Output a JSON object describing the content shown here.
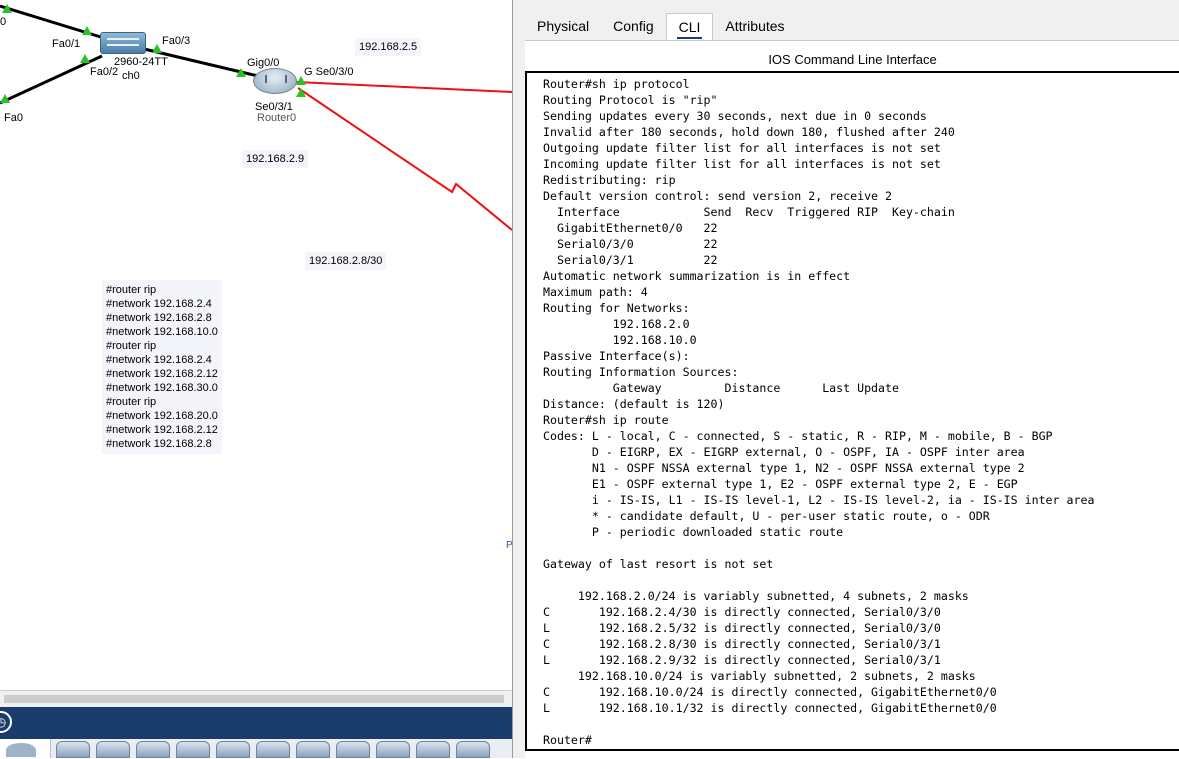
{
  "workspace": {
    "links": {
      "black_color": "#000000",
      "red_color": "#ee1111",
      "port_color": "#29c229"
    },
    "labels": {
      "top_left_cut": "0",
      "fa01": "Fa0/1",
      "fa03": "Fa0/3",
      "fa02": "Fa0/2",
      "switch_model": "2960-24TT",
      "switch_name": "ch0",
      "fa0": "Fa0",
      "gig00": "Gig0/0",
      "se030": "G Se0/3/0",
      "se031": "Se0/3/1",
      "router_name": "Router0"
    },
    "ip_notes": {
      "ip_2_5": "192.168.2.5",
      "ip_2_9": "192.168.2.9",
      "ip_2_8_30": "192.168.2.8/30"
    },
    "rip_notes": [
      "#router rip",
      "#network 192.168.2.4",
      "#network 192.168.2.8",
      "#network 192.168.10.0",
      "#router rip",
      "#network 192.168.2.4",
      "#network 192.168.2.12",
      "#network 192.168.30.0",
      "#router rip",
      "#network 192.168.20.0",
      "#network 192.168.2.12",
      "#network 192.168.2.8"
    ],
    "pc_stub_label": "P"
  },
  "toolbar": {
    "bar_color": "#1a3c6b",
    "clock_icon": "clock-icon"
  },
  "cli": {
    "tabs": [
      {
        "label": "Physical",
        "active": false
      },
      {
        "label": "Config",
        "active": false
      },
      {
        "label": "CLI",
        "active": true
      },
      {
        "label": "Attributes",
        "active": false
      }
    ],
    "title": "IOS Command Line Interface",
    "output": "Router#sh ip protocol\nRouting Protocol is \"rip\"\nSending updates every 30 seconds, next due in 0 seconds\nInvalid after 180 seconds, hold down 180, flushed after 240\nOutgoing update filter list for all interfaces is not set\nIncoming update filter list for all interfaces is not set\nRedistributing: rip\nDefault version control: send version 2, receive 2\n  Interface            Send  Recv  Triggered RIP  Key-chain\n  GigabitEthernet0/0   22\n  Serial0/3/0          22\n  Serial0/3/1          22\nAutomatic network summarization is in effect\nMaximum path: 4\nRouting for Networks:\n          192.168.2.0\n          192.168.10.0\nPassive Interface(s):\nRouting Information Sources:\n          Gateway         Distance      Last Update\nDistance: (default is 120)\nRouter#sh ip route\nCodes: L - local, C - connected, S - static, R - RIP, M - mobile, B - BGP\n       D - EIGRP, EX - EIGRP external, O - OSPF, IA - OSPF inter area\n       N1 - OSPF NSSA external type 1, N2 - OSPF NSSA external type 2\n       E1 - OSPF external type 1, E2 - OSPF external type 2, E - EGP\n       i - IS-IS, L1 - IS-IS level-1, L2 - IS-IS level-2, ia - IS-IS inter area\n       * - candidate default, U - per-user static route, o - ODR\n       P - periodic downloaded static route\n\nGateway of last resort is not set\n\n     192.168.2.0/24 is variably subnetted, 4 subnets, 2 masks\nC       192.168.2.4/30 is directly connected, Serial0/3/0\nL       192.168.2.5/32 is directly connected, Serial0/3/0\nC       192.168.2.8/30 is directly connected, Serial0/3/1\nL       192.168.2.9/32 is directly connected, Serial0/3/1\n     192.168.10.0/24 is variably subnetted, 2 subnets, 2 masks\nC       192.168.10.0/24 is directly connected, GigabitEthernet0/0\nL       192.168.10.1/32 is directly connected, GigabitEthernet0/0\n\nRouter#"
  }
}
